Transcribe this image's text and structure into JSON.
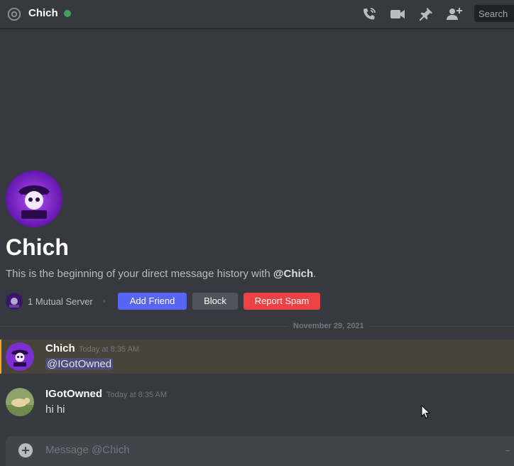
{
  "header": {
    "title": "Chich",
    "status": "online",
    "status_color": "#3ba55d",
    "icons": [
      "at-icon",
      "phone-call-icon",
      "video-call-icon",
      "pin-icon",
      "add-friend-icon"
    ],
    "search_placeholder": "Search"
  },
  "intro": {
    "name": "Chich",
    "text_prefix": "This is the beginning of your direct message history with ",
    "text_mention": "@Chich",
    "text_suffix": ".",
    "mutual_servers": "1 Mutual Server",
    "add_friend_label": "Add Friend",
    "block_label": "Block",
    "report_label": "Report Spam",
    "avatar_text": "CHICH"
  },
  "divider_date": "November 29, 2021",
  "messages": [
    {
      "author": "Chich",
      "timestamp": "Today at 8:35 AM",
      "text": "@IGotOwned",
      "is_mention": true,
      "highlight_color": "#faa81a"
    },
    {
      "author": "IGotOwned",
      "timestamp": "Today at 8:35 AM",
      "text": "hi hi",
      "is_mention": false
    }
  ],
  "composer": {
    "placeholder": "Message @Chich"
  },
  "colors": {
    "background": "#36393f",
    "blurple": "#5865f2",
    "danger": "#ed4245",
    "secondary": "#4f545c"
  }
}
